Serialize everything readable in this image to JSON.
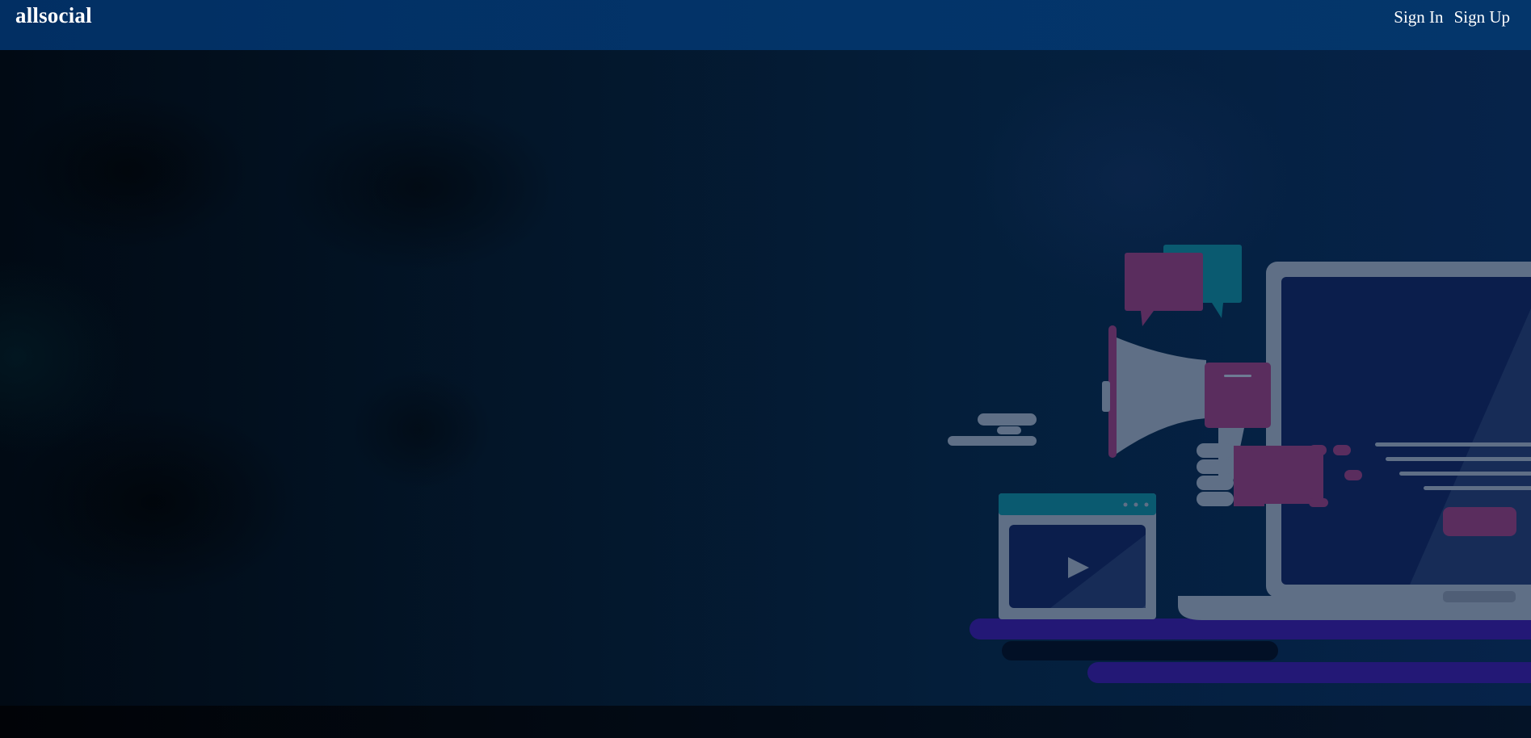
{
  "header": {
    "brand": "allsocial",
    "nav": [
      {
        "label": "Sign In"
      },
      {
        "label": "Sign Up"
      }
    ]
  },
  "hero": {
    "illustration": "megaphone-social-marketing-illustration"
  },
  "colors": {
    "navbar": "#033469",
    "hero_dark": "#01070f",
    "accent_magenta": "#5a2d5e",
    "accent_teal": "#0a5a70",
    "accent_purple": "#231876",
    "device_gray": "#5f6f86"
  }
}
